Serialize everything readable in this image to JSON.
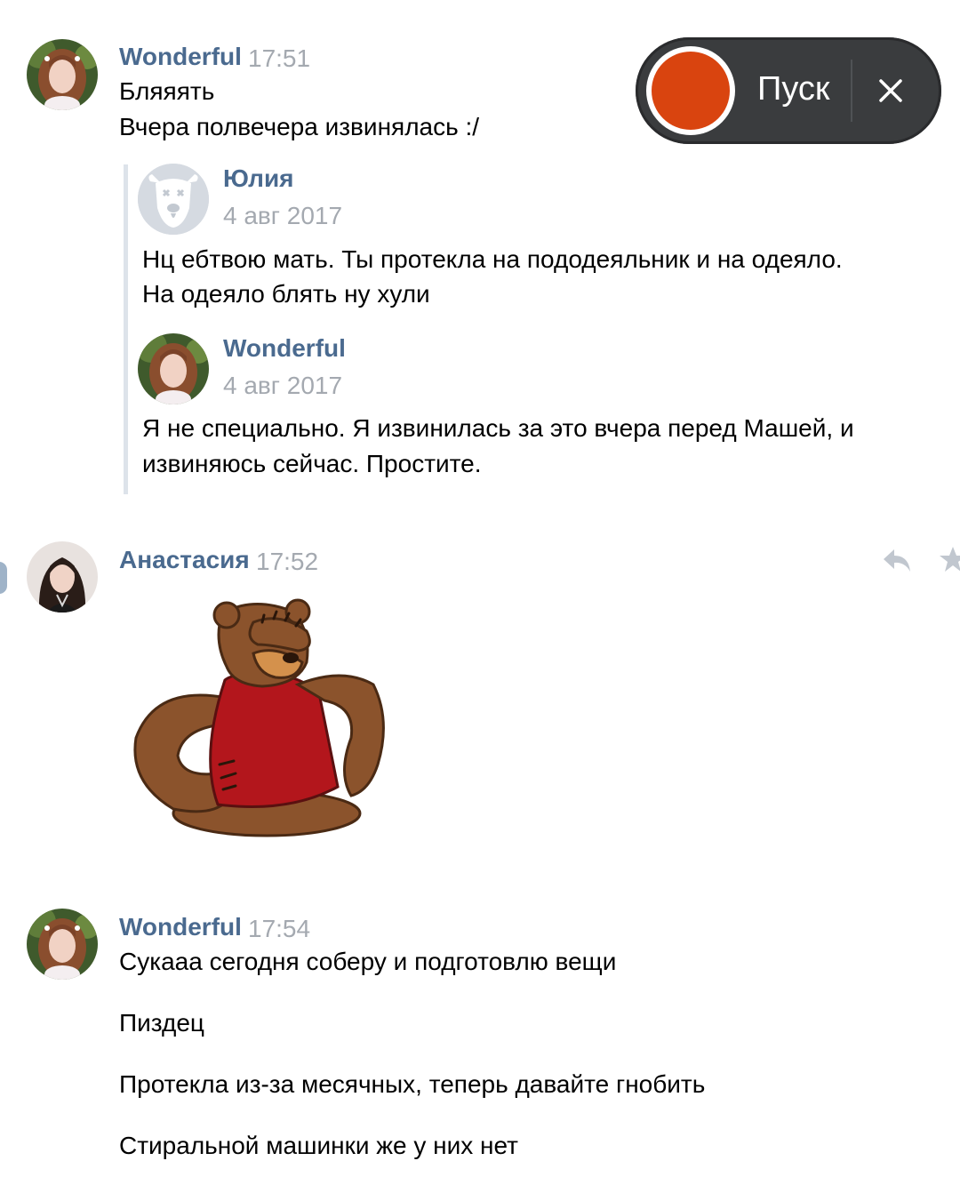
{
  "messages": [
    {
      "author": "Wonderful",
      "time": "17:51",
      "lines": [
        "Бляяять",
        "Вчера полвечера извинялась :/"
      ],
      "forwarded": [
        {
          "author": "Юлия",
          "date": "4 авг 2017",
          "lines": [
            "Нц ебтвою мать. Ты протекла на пододеяльник и на одеяло.",
            "На одеяло блять ну хули"
          ]
        },
        {
          "author": "Wonderful",
          "date": "4 авг 2017",
          "lines": [
            "Я не специально. Я извинилась за это вчера перед Машей, и",
            "извиняюсь сейчас. Простите."
          ]
        }
      ]
    },
    {
      "author": "Анастасия",
      "time": "17:52",
      "sticker": "bear-facepalm-sticker"
    },
    {
      "author": "Wonderful",
      "time": "17:54",
      "lines": [
        "Сукааа сегодня соберу и подготовлю вещи",
        "Пиздец",
        "Протекла из-за месячных, теперь давайте гнобить",
        "Стиральной машинки же у них нет"
      ]
    }
  ],
  "recorder": {
    "label": "Пуск",
    "record_icon": "record-icon",
    "close_icon": "close-icon",
    "accent": "#d9440f"
  },
  "colors": {
    "author": "#4a6a8f",
    "time": "#a4a9b0",
    "quote_bar": "#dde3ea"
  }
}
